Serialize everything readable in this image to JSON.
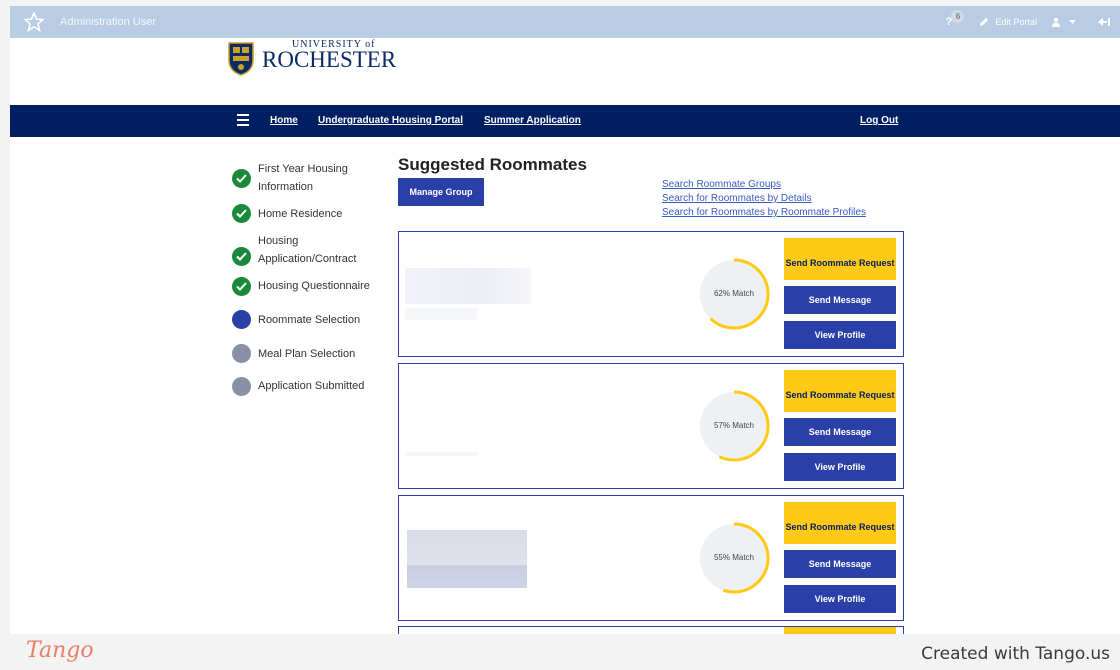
{
  "admin_bar": {
    "user": "Administration User",
    "notification_count": "6",
    "help_glyph": "?",
    "edit_portal": "Edit Portal",
    "icons": [
      "star-icon",
      "pencil-icon",
      "user-icon",
      "caret-down-icon",
      "collapse-arrow-icon"
    ]
  },
  "logo": {
    "line1": "UNIVERSITY of",
    "line2": "ROCHESTER"
  },
  "nav": {
    "home": "Home",
    "portal": "Undergraduate Housing Portal",
    "summer": "Summer Application",
    "logout": "Log Out"
  },
  "steps": [
    {
      "label": "First Year Housing Information",
      "status": "done"
    },
    {
      "label": "Home Residence",
      "status": "done"
    },
    {
      "label": "Housing Application/Contract",
      "status": "done"
    },
    {
      "label": "Housing Questionnaire",
      "status": "done"
    },
    {
      "label": "Roommate Selection",
      "status": "current"
    },
    {
      "label": "Meal Plan Selection",
      "status": "todo"
    },
    {
      "label": "Application Submitted",
      "status": "todo"
    }
  ],
  "main": {
    "title": "Suggested Roommates",
    "manage_group": "Manage Group",
    "links": [
      "Search Roommate Groups",
      "Search for Roommates by Details",
      "Search for Roommates by Roommate Profiles"
    ]
  },
  "cards": [
    {
      "match": "62% Match",
      "match_value": 62,
      "request": "Send Roommate Request",
      "message": "Send Message",
      "profile": "View Profile"
    },
    {
      "match": "57% Match",
      "match_value": 57,
      "request": "Send Roommate Request",
      "message": "Send Message",
      "profile": "View Profile"
    },
    {
      "match": "55% Match",
      "match_value": 55,
      "request": "Send Roommate Request",
      "message": "Send Message",
      "profile": "View Profile"
    }
  ],
  "footer": {
    "logo": "Tango",
    "credit": "Created with Tango.us"
  },
  "colors": {
    "admin_bar": "#b8cde3",
    "nav": "#001e62",
    "primary_button": "#2a3fa8",
    "accent_yellow": "#ffc915",
    "done_green": "#1a8a3a"
  }
}
